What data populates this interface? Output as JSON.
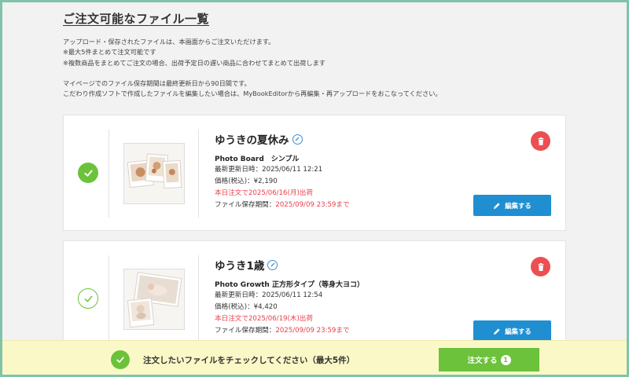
{
  "page": {
    "title": "ご注文可能なファイル一覧",
    "notes": [
      "アップロード・保存されたファイルは、本画面からご注文いただけます。",
      "※最大5件まとめて注文可能です",
      "※複数商品をまとめてご注文の場合、出荷予定日の遅い商品に合わせてまとめて出荷します"
    ],
    "notes2": [
      "マイページでのファイル保存期間は最終更新日から90日間です。",
      "こだわり作成ソフトで作成したファイルを編集したい場合は、MyBookEditorから再編集・再アップロードをおこなってください。"
    ]
  },
  "items": [
    {
      "name": "ゆうきの夏休み",
      "product": "Photo Board　シンプル",
      "updated": "最新更新日時：2025/06/11 12:21",
      "price": "価格(税込)：¥2,190",
      "ship": "本日注文で2025/06/16(月)出荷",
      "storage_label": "ファイル保存期間：",
      "storage_value": "2025/09/09 23:59まで",
      "edit_label": "編集する",
      "checked": true
    },
    {
      "name": "ゆうき1歳",
      "product": "Photo Growth 正方形タイプ（等身大ヨコ）",
      "updated": "最新更新日時：2025/06/11 12:54",
      "price": "価格(税込)：¥4,420",
      "ship": "本日注文で2025/06/19(木)出荷",
      "storage_label": "ファイル保存期間：",
      "storage_value": "2025/09/09 23:59まで",
      "edit_label": "編集する",
      "checked": false
    }
  ],
  "footer": {
    "message": "注文したいファイルをチェックしてください（最大5件）",
    "order_label": "注文する",
    "order_count": "1"
  },
  "colors": {
    "green": "#6cc23a",
    "blue": "#1f8fd2",
    "red": "#e9404a",
    "frame": "#7fc3a8",
    "footer_bg": "#fbf8c7"
  },
  "icons": [
    "check-icon",
    "pencil-icon",
    "trash-icon"
  ]
}
